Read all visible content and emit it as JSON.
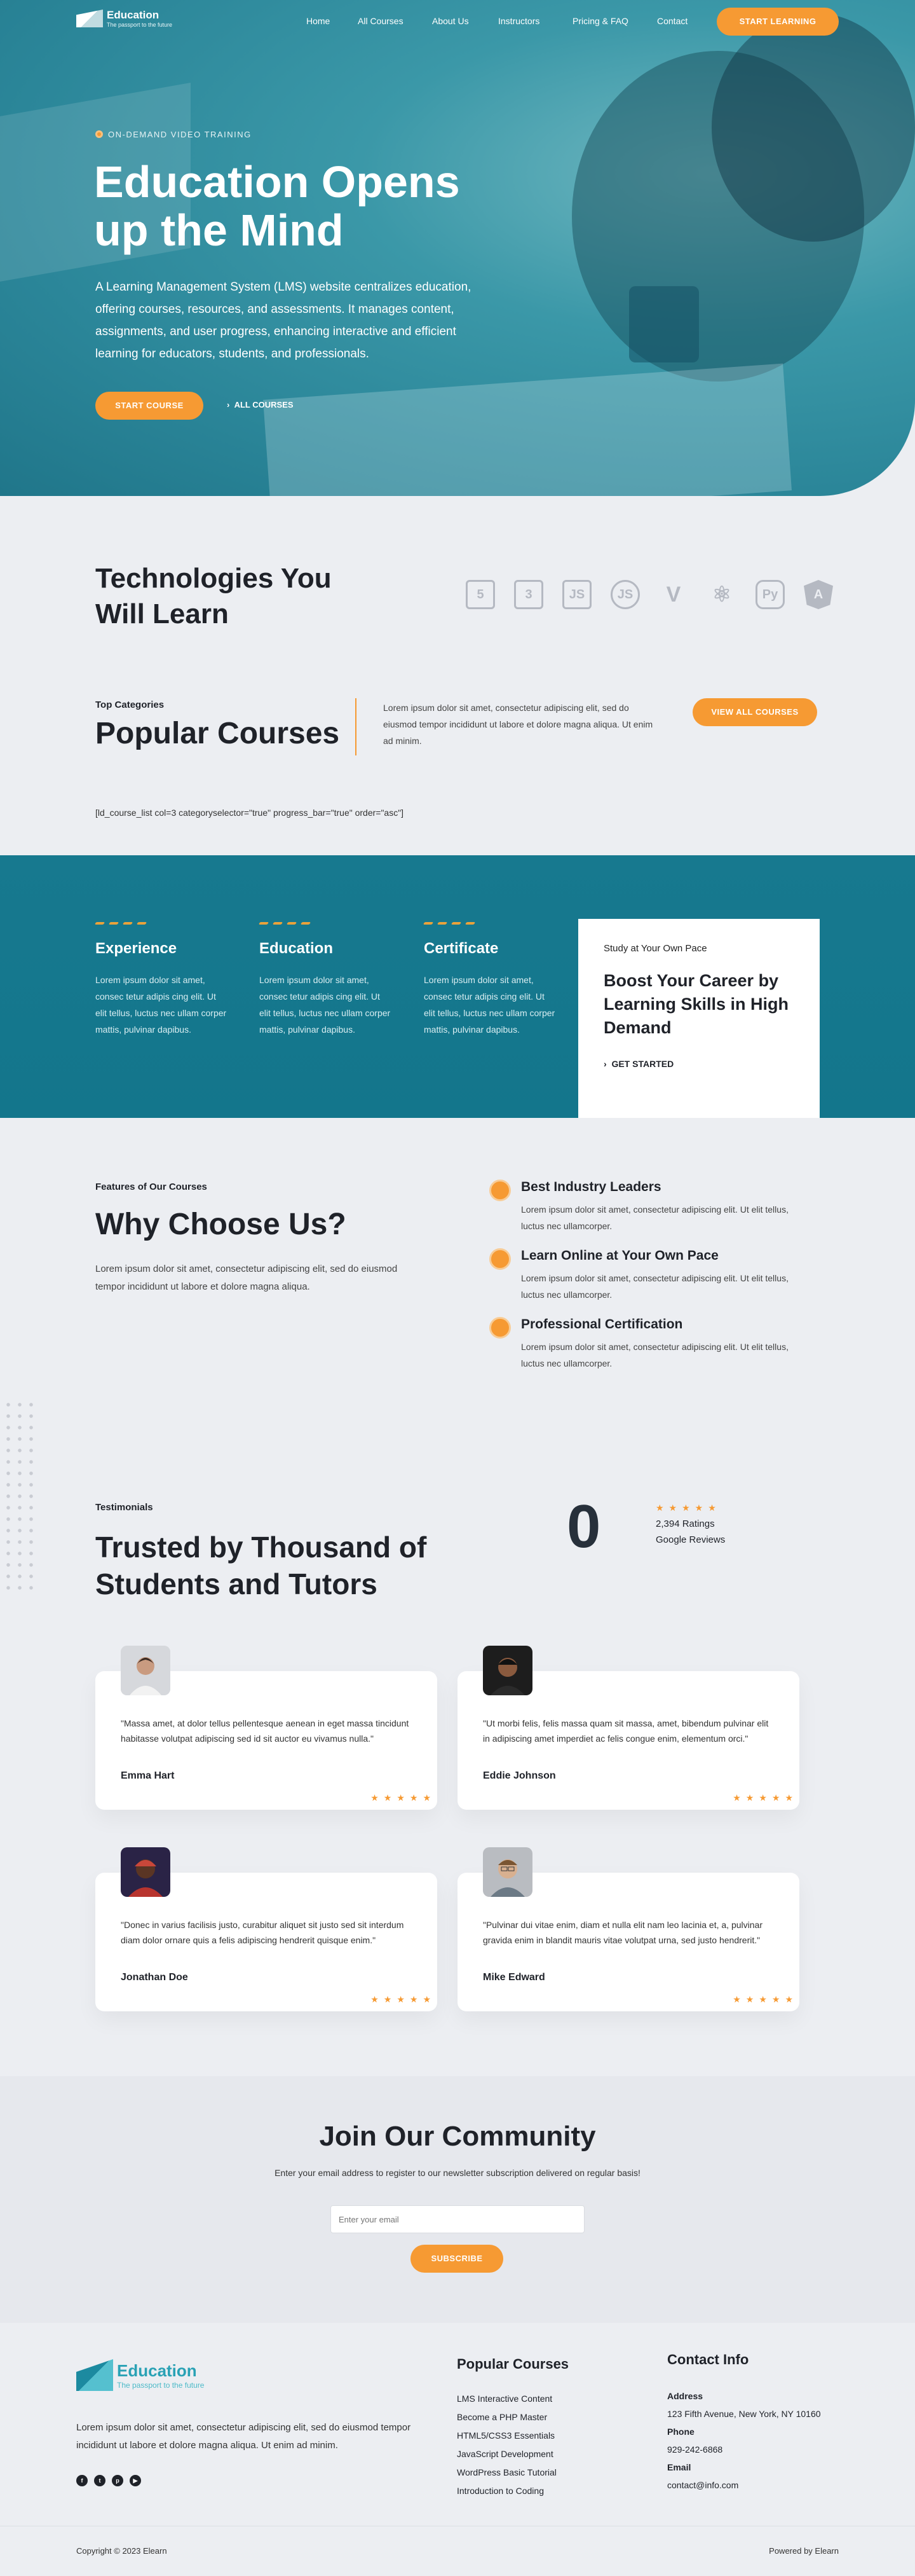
{
  "header": {
    "logo_name": "Education",
    "logo_tagline": "The passport to the future",
    "nav": [
      "Home",
      "All Courses",
      "About Us",
      "Instructors",
      "Pricing & FAQ",
      "Contact"
    ],
    "cta": "START LEARNING"
  },
  "hero": {
    "pretitle": "ON-DEMAND VIDEO TRAINING",
    "title": "Education Opens up the Mind",
    "description": "A Learning Management System (LMS) website centralizes education, offering courses, resources, and assessments. It manages content, assignments, and user progress, enhancing interactive and efficient learning for educators, students, and professionals.",
    "primary_button": "START COURSE",
    "secondary_button": "ALL COURSES"
  },
  "technologies": {
    "title": "Technologies You Will Learn",
    "icons": [
      {
        "icon": "html5-icon",
        "glyph": "5"
      },
      {
        "icon": "css3-icon",
        "glyph": "3"
      },
      {
        "icon": "javascript-icon",
        "glyph": "JS"
      },
      {
        "icon": "nodejs-icon",
        "glyph": "JS"
      },
      {
        "icon": "vue-icon",
        "glyph": "V"
      },
      {
        "icon": "react-icon",
        "glyph": "⚛"
      },
      {
        "icon": "python-icon",
        "glyph": "Py"
      },
      {
        "icon": "angular-icon",
        "glyph": "A"
      }
    ]
  },
  "popular": {
    "subtitle": "Top Categories",
    "title": "Popular Courses",
    "description": "Lorem ipsum dolor sit amet, consectetur adipiscing elit, sed do eiusmod tempor incididunt ut labore et dolore magna aliqua. Ut enim ad minim.",
    "button": "VIEW ALL COURSES",
    "shortcode": "[ld_course_list col=3 categoryselector=\"true\" progress_bar=\"true\" order=\"asc\"]"
  },
  "features": [
    {
      "title": "Experience",
      "text": "Lorem ipsum dolor sit amet, consec tetur adipis cing elit. Ut elit tellus, luctus nec ullam corper mattis, pulvinar dapibus."
    },
    {
      "title": "Education",
      "text": "Lorem ipsum dolor sit amet, consec tetur adipis cing elit. Ut elit tellus, luctus nec ullam corper mattis, pulvinar dapibus."
    },
    {
      "title": "Certificate",
      "text": "Lorem ipsum dolor sit amet, consec tetur adipis cing elit. Ut elit tellus, luctus nec ullam corper mattis, pulvinar dapibus."
    }
  ],
  "boost_card": {
    "kicker": "Study at Your Own Pace",
    "title": "Boost Your Career by Learning Skills in High Demand",
    "link": "GET STARTED"
  },
  "why": {
    "subtitle": "Features of Our Courses",
    "title": "Why Choose Us?",
    "description": "Lorem ipsum dolor sit amet, consectetur adipiscing elit, sed do eiusmod tempor incididunt ut labore et dolore magna aliqua.",
    "items": [
      {
        "title": "Best Industry Leaders",
        "text": "Lorem ipsum dolor sit amet, consectetur adipiscing elit. Ut elit tellus, luctus nec ullamcorper."
      },
      {
        "title": "Learn Online at Your Own Pace",
        "text": "Lorem ipsum dolor sit amet, consectetur adipiscing elit. Ut elit tellus, luctus nec ullamcorper."
      },
      {
        "title": "Professional Certification",
        "text": "Lorem ipsum dolor sit amet, consectetur adipiscing elit. Ut elit tellus, luctus nec ullamcorper."
      }
    ]
  },
  "testimonials": {
    "subtitle": "Testimonials",
    "title": "Trusted by Thousand of Students and Tutors",
    "counter": "0",
    "stars": "★★★★★",
    "ratings": "2,394 Ratings",
    "source": "Google Reviews",
    "items": [
      {
        "quote": "\"Massa amet, at dolor tellus pellentesque aenean in eget massa tincidunt habitasse volutpat adipiscing sed id sit auctor eu vivamus nulla.\"",
        "name": "Emma Hart"
      },
      {
        "quote": "\"Ut morbi felis, felis massa quam sit massa, amet, bibendum pulvinar elit in adipiscing amet imperdiet ac felis congue enim, elementum orci.\"",
        "name": "Eddie Johnson"
      },
      {
        "quote": "\"Donec in varius facilisis justo, curabitur aliquet sit justo sed sit interdum diam dolor ornare quis a felis adipiscing hendrerit quisque enim.\"",
        "name": "Jonathan Doe"
      },
      {
        "quote": "\"Pulvinar dui vitae enim, diam et nulla elit nam leo lacinia et, a, pulvinar gravida enim in blandit mauris vitae volutpat urna, sed justo hendrerit.\"",
        "name": "Mike Edward"
      }
    ]
  },
  "community": {
    "title": "Join Our Community",
    "description": "Enter your email address to register to our newsletter subscription delivered on regular basis!",
    "placeholder": "Enter your email",
    "button": "SUBSCRIBE"
  },
  "footer": {
    "logo_name": "Education",
    "logo_tagline": "The passport to the future",
    "description": "Lorem ipsum dolor sit amet, consectetur adipiscing elit, sed do eiusmod tempor incididunt ut labore et dolore magna aliqua. Ut enim ad minim.",
    "social": [
      {
        "icon": "facebook-icon",
        "glyph": "f"
      },
      {
        "icon": "twitter-icon",
        "glyph": "t"
      },
      {
        "icon": "pinterest-icon",
        "glyph": "p"
      },
      {
        "icon": "youtube-icon",
        "glyph": "▶"
      }
    ],
    "courses_title": "Popular Courses",
    "courses": [
      "LMS Interactive Content",
      "Become a PHP Master",
      "HTML5/CSS3 Essentials",
      "JavaScript Development",
      "WordPress Basic Tutorial",
      "Introduction to Coding"
    ],
    "contact_title": "Contact Info",
    "address_label": "Address",
    "address": "123 Fifth Avenue, New York, NY 10160",
    "phone_label": "Phone",
    "phone": "929-242-6868",
    "email_label": "Email",
    "email": "contact@info.com",
    "copyright": "Copyright © 2023 Elearn",
    "powered": "Powered by Elearn"
  },
  "colors": {
    "accent": "#f69a33",
    "teal": "#17798f",
    "text": "#1f2229"
  }
}
